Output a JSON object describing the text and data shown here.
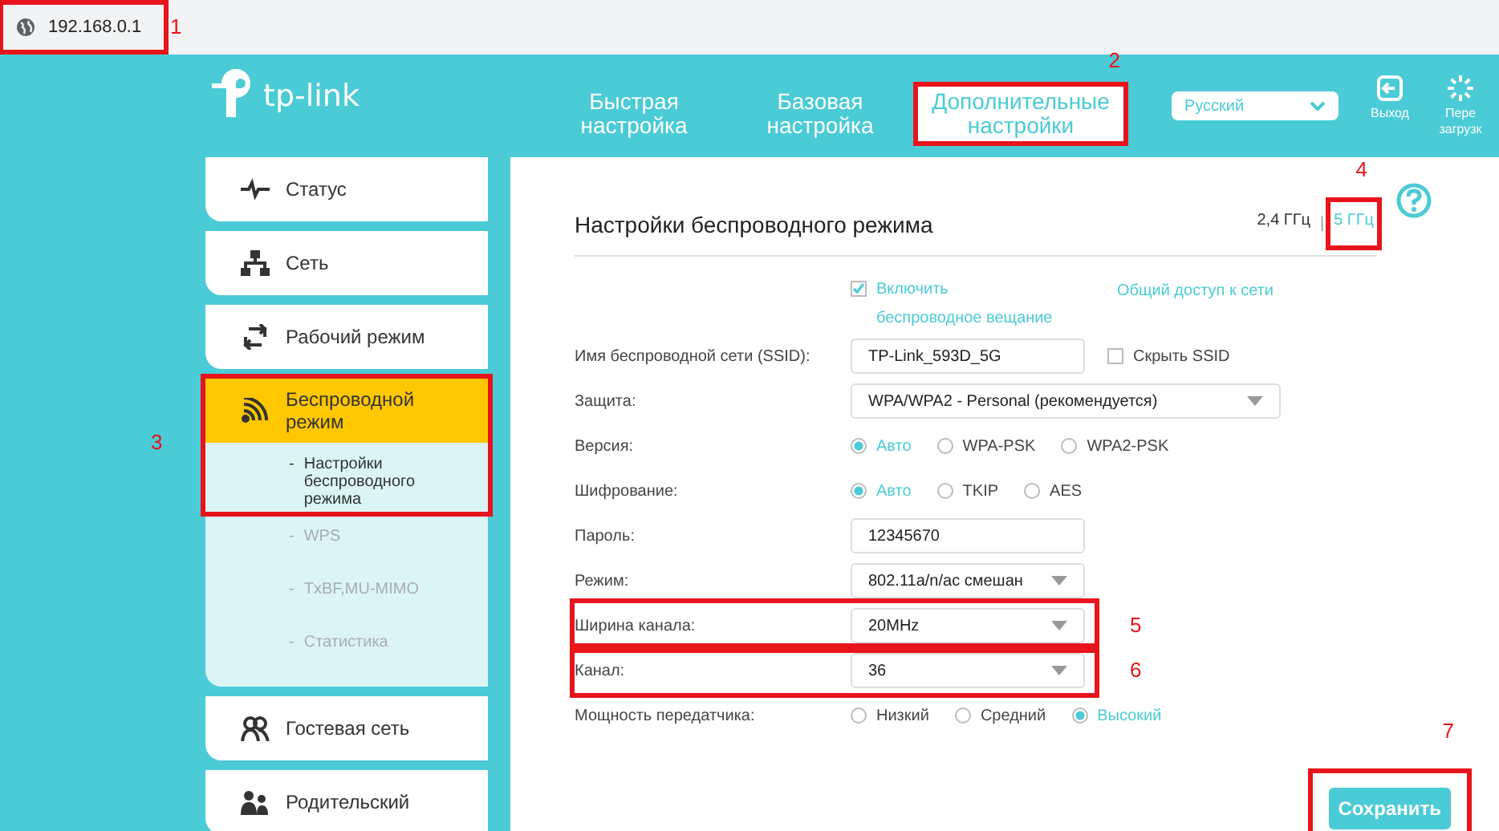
{
  "address_bar": {
    "url": "192.168.0.1",
    "annotation": "1"
  },
  "logo": {
    "text": "tp-link"
  },
  "nav_tabs": [
    {
      "label": "Быстрая настройка",
      "selected": false
    },
    {
      "label": "Базовая настройка",
      "selected": false
    },
    {
      "label": "Дополнительные настройки",
      "selected": true,
      "annotation": "2"
    }
  ],
  "language": {
    "value": "Русский"
  },
  "header_actions": [
    {
      "kind": "logout",
      "label": "Выход"
    },
    {
      "kind": "reboot",
      "label": "Пере загрузк"
    }
  ],
  "sidebar": {
    "items": [
      {
        "kind": "status",
        "label": "Статус",
        "selected": false
      },
      {
        "kind": "network",
        "label": "Сеть",
        "selected": false
      },
      {
        "kind": "mode",
        "label": "Рабочий режим",
        "selected": false
      },
      {
        "kind": "wireless",
        "label": "Беспроводной режим",
        "selected": true,
        "expanded": true,
        "annotation": "3",
        "children": [
          {
            "dash": "-",
            "label": "Настройки беспроводного режима",
            "selected": true
          },
          {
            "dash": "-",
            "label": "WPS",
            "selected": false
          },
          {
            "dash": "-",
            "label": "TxBF,MU-MIMO",
            "selected": false
          },
          {
            "dash": "-",
            "label": "Статистика",
            "selected": false
          }
        ]
      },
      {
        "kind": "guest",
        "label": "Гостевая сеть",
        "selected": false
      },
      {
        "kind": "parental",
        "label": "Родительский",
        "selected": false
      }
    ]
  },
  "panel": {
    "title": "Настройки беспроводного режима",
    "band_separator": "|",
    "bands": [
      {
        "label": "2,4 ГГц",
        "selected": false
      },
      {
        "label": "5 ГГц",
        "selected": true,
        "annotation": "4"
      }
    ],
    "enable": {
      "label": "Включить беспроводное вещание",
      "checked": true
    },
    "share_link": "Общий доступ к сети",
    "rows": [
      {
        "kind": "text",
        "label": "Имя беспроводной сети (SSID):",
        "value": "TP-Link_593D_5G",
        "checkbox": {
          "label": "Скрыть SSID",
          "checked": false
        }
      },
      {
        "kind": "select",
        "label": "Защита:",
        "value": "WPA/WPA2 - Personal (рекомендуется)",
        "wide": true
      },
      {
        "kind": "radio",
        "label": "Версия:",
        "options": [
          {
            "label": "Авто",
            "selected": true
          },
          {
            "label": "WPA-PSK",
            "selected": false
          },
          {
            "label": "WPA2-PSK",
            "selected": false
          }
        ]
      },
      {
        "kind": "radio",
        "label": "Шифрование:",
        "options": [
          {
            "label": "Авто",
            "selected": true
          },
          {
            "label": "TKIP",
            "selected": false
          },
          {
            "label": "AES",
            "selected": false
          }
        ]
      },
      {
        "kind": "text",
        "label": "Пароль:",
        "value": "12345670"
      },
      {
        "kind": "select",
        "label": "Режим:",
        "value": "802.11a/n/ac смешан"
      },
      {
        "kind": "select",
        "label": "Ширина канала:",
        "value": "20MHz",
        "annotation": "5"
      },
      {
        "kind": "select",
        "label": "Канал:",
        "value": "36",
        "annotation": "6"
      },
      {
        "kind": "radio",
        "label": "Мощность передатчика:",
        "options": [
          {
            "label": "Низкий",
            "selected": false
          },
          {
            "label": "Средний",
            "selected": false
          },
          {
            "label": "Высокий",
            "selected": true
          }
        ]
      }
    ],
    "save_button": {
      "label": "Сохранить",
      "annotation": "7"
    }
  }
}
